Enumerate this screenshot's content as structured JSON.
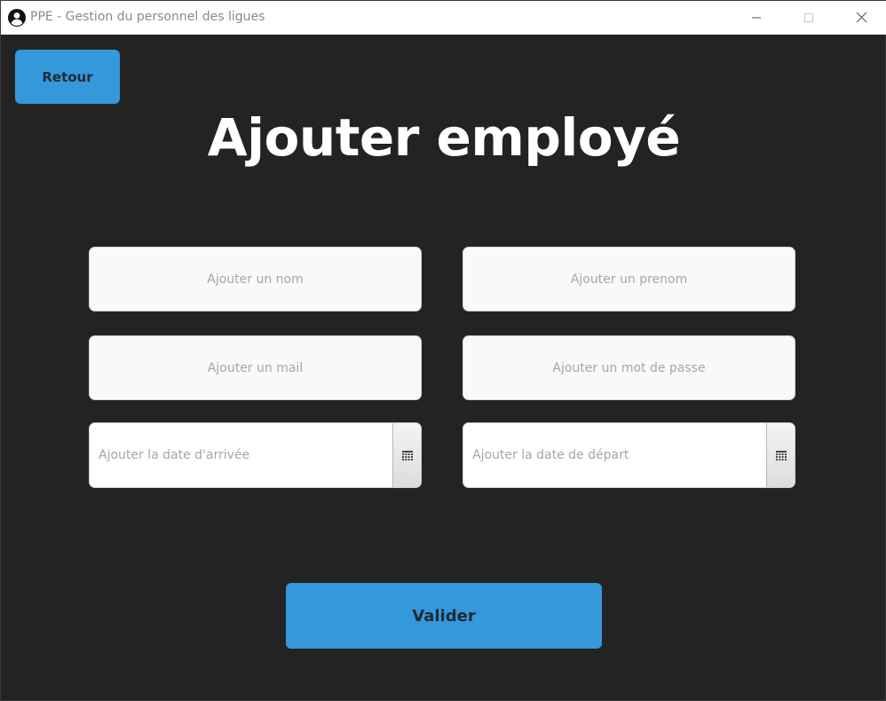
{
  "window": {
    "title": "PPE - Gestion du personnel des ligues",
    "icons": {
      "app": "user-circle-icon",
      "minimize": "minimize-icon",
      "maximize": "maximize-icon",
      "close": "close-icon"
    }
  },
  "toolbar": {
    "back_label": "Retour"
  },
  "page": {
    "title": "Ajouter employé"
  },
  "form": {
    "nom": {
      "value": "",
      "placeholder": "Ajouter un nom"
    },
    "prenom": {
      "value": "",
      "placeholder": "Ajouter un prenom"
    },
    "mail": {
      "value": "",
      "placeholder": "Ajouter un mail"
    },
    "mot_de_passe": {
      "value": "",
      "placeholder": "Ajouter un mot de passe"
    },
    "date_arrivee": {
      "value": "",
      "placeholder": "Ajouter la date d'arrivée",
      "picker_icon": "calendar-icon"
    },
    "date_depart": {
      "value": "",
      "placeholder": "Ajouter la date de départ",
      "picker_icon": "calendar-icon"
    },
    "submit_label": "Valider"
  },
  "colors": {
    "background": "#232323",
    "accent": "#3498db",
    "title_text": "#ffffff",
    "field_background": "#f9f9f9",
    "placeholder": "#a6a6a6"
  }
}
